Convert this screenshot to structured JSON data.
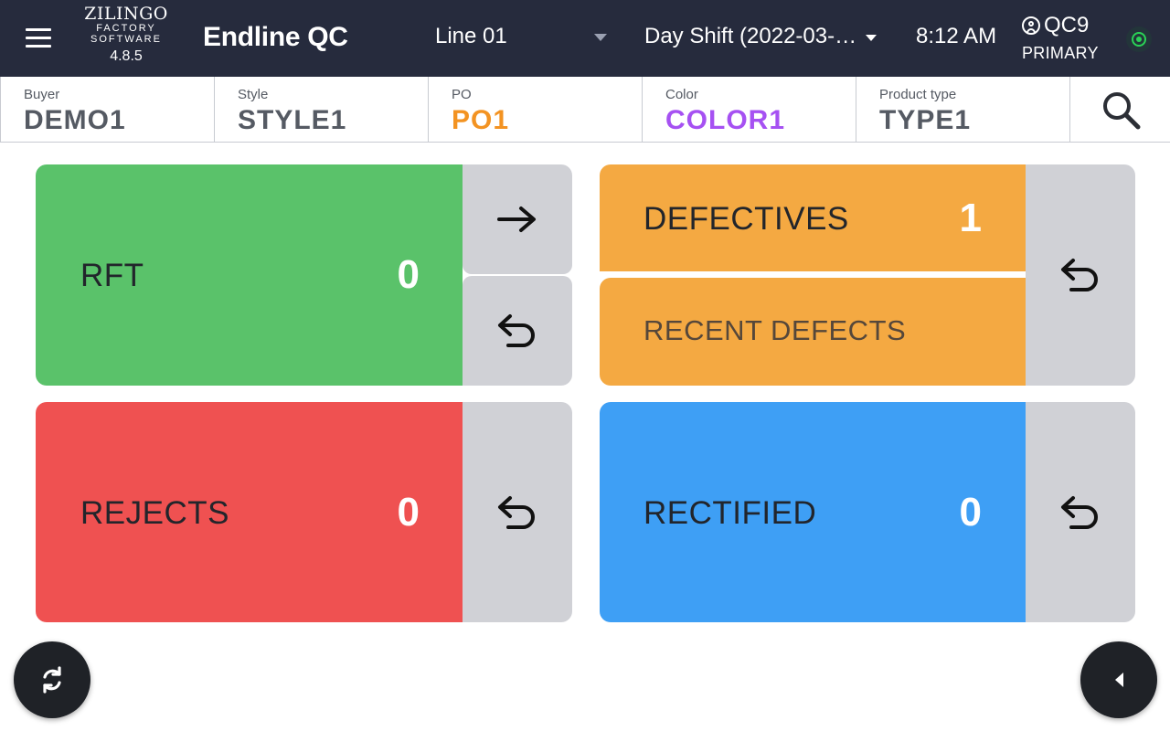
{
  "header": {
    "logo": {
      "brand": "ZILINGO",
      "sub_line1": "FACTORY",
      "sub_line2": "SOFTWARE",
      "version": "4.8.5"
    },
    "title": "Endline QC",
    "line_select": {
      "value": "Line 01"
    },
    "shift_select": {
      "value": "Day Shift (2022-03-…"
    },
    "time": "8:12 AM",
    "user": {
      "name": "QC9",
      "role": "PRIMARY"
    },
    "status_color": "#2ad356"
  },
  "filters": [
    {
      "label": "Buyer",
      "value": "DEMO1",
      "color": "#555a63"
    },
    {
      "label": "Style",
      "value": "STYLE1",
      "color": "#555a63"
    },
    {
      "label": "PO",
      "value": "PO1",
      "color": "#f39322"
    },
    {
      "label": "Color",
      "value": "COLOR1",
      "color": "#a651f2"
    },
    {
      "label": "Product type",
      "value": "TYPE1",
      "color": "#555a63"
    }
  ],
  "cards": {
    "rft": {
      "label": "RFT",
      "count": "0",
      "color": "#5ac26a"
    },
    "defectives": {
      "label": "DEFECTIVES",
      "count": "1",
      "color": "#f4a942"
    },
    "recent_defects": {
      "label": "RECENT DEFECTS",
      "color": "#f4a942"
    },
    "rejects": {
      "label": "REJECTS",
      "count": "0",
      "color": "#ef5151"
    },
    "rectified": {
      "label": "RECTIFIED",
      "count": "0",
      "color": "#3e9ff5"
    }
  },
  "icons": {
    "menu": "hamburger-icon",
    "search": "search-icon",
    "next": "arrow-right-icon",
    "undo": "undo-icon",
    "refresh": "refresh-icon",
    "back": "caret-left-icon",
    "user": "user-circle-icon"
  }
}
